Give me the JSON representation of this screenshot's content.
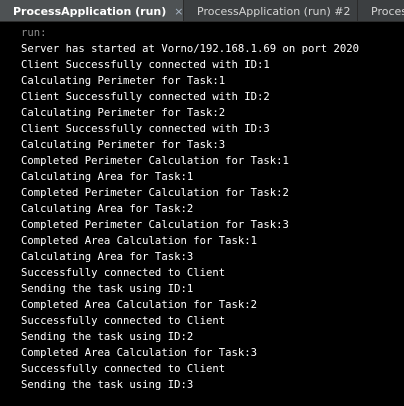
{
  "tabs": [
    {
      "label": "ProcessApplication (run)",
      "active": true,
      "close_icon": "×"
    },
    {
      "label": "ProcessApplication (run) #2",
      "active": false,
      "close_icon": "×"
    },
    {
      "label": "ProcessA",
      "active": false,
      "close_icon": ""
    }
  ],
  "console": {
    "lines": [
      "run:",
      "Server has started at Vorno/192.168.1.69 on port 2020",
      "Client Successfully connected with ID:1",
      "Calculating Perimeter for Task:1",
      "Client Successfully connected with ID:2",
      "Calculating Perimeter for Task:2",
      "Client Successfully connected with ID:3",
      "Calculating Perimeter for Task:3",
      "Completed Perimeter Calculation for Task:1",
      "Calculating Area for Task:1",
      "Completed Perimeter Calculation for Task:2",
      "Calculating Area for Task:2",
      "Completed Perimeter Calculation for Task:3",
      "Completed Area Calculation for Task:1",
      "Calculating Area for Task:3",
      "Successfully connected to Client",
      "Sending the task using ID:1",
      "Completed Area Calculation for Task:2",
      "Successfully connected to Client",
      "Sending the task using ID:2",
      "Completed Area Calculation for Task:3",
      "Successfully connected to Client",
      "Sending the task using ID:3"
    ]
  },
  "colors": {
    "console_background": "#000000",
    "console_text": "#ffffff",
    "tab_active": "#4e5254",
    "tab_inactive": "#3c3f41"
  }
}
